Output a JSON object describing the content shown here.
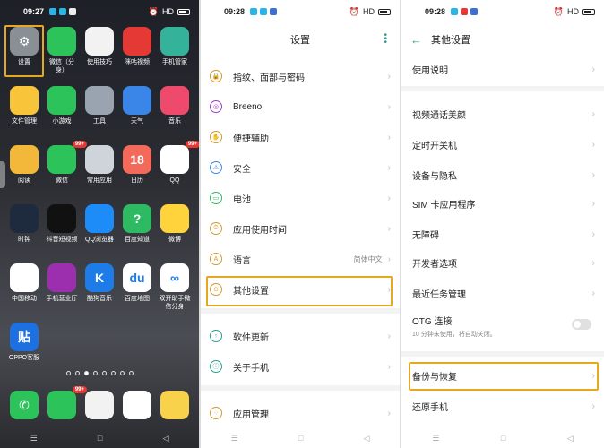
{
  "home": {
    "time": "09:27",
    "apps": [
      {
        "name": "settings",
        "label": "设置",
        "color": "#8a8f96",
        "glyph": "⚙",
        "badge": ""
      },
      {
        "name": "wechat-clone",
        "label": "微信（分\n身）",
        "color": "#2dc35b",
        "glyph": "",
        "badge": ""
      },
      {
        "name": "tips",
        "label": "使用技巧",
        "color": "#f2f2f2",
        "glyph": "",
        "badge": ""
      },
      {
        "name": "miguvideo",
        "label": "咪咕视频",
        "color": "#e53935",
        "glyph": "",
        "badge": ""
      },
      {
        "name": "phone-manager",
        "label": "手机管家",
        "color": "#35b39a",
        "glyph": "",
        "badge": ""
      },
      {
        "name": "file-manager",
        "label": "文件管理",
        "color": "#f7c43a",
        "glyph": "",
        "badge": ""
      },
      {
        "name": "mini-games",
        "label": "小游戏",
        "color": "#2dc35b",
        "glyph": "",
        "badge": ""
      },
      {
        "name": "tools",
        "label": "工具",
        "color": "#9aa3b0",
        "glyph": "",
        "badge": ""
      },
      {
        "name": "weather",
        "label": "天气",
        "color": "#3a86e8",
        "glyph": "",
        "badge": ""
      },
      {
        "name": "music",
        "label": "音乐",
        "color": "#ef4a6b",
        "glyph": "",
        "badge": ""
      },
      {
        "name": "reading",
        "label": "阅读",
        "color": "#f3b73a",
        "glyph": "",
        "badge": ""
      },
      {
        "name": "wechat",
        "label": "微信",
        "color": "#2dc35b",
        "glyph": "",
        "badge": "99+"
      },
      {
        "name": "common-apps",
        "label": "常用应用",
        "color": "#cfd3da",
        "glyph": "",
        "badge": ""
      },
      {
        "name": "calendar",
        "label": "日历",
        "color": "#f36a5a",
        "glyph": "18",
        "badge": ""
      },
      {
        "name": "qq",
        "label": "QQ",
        "color": "#ffffff",
        "glyph": "",
        "badge": "99+"
      },
      {
        "name": "clock",
        "label": "时钟",
        "color": "#1e2a3d",
        "glyph": "",
        "badge": ""
      },
      {
        "name": "douyin",
        "label": "抖音短视频",
        "color": "#111111",
        "glyph": "",
        "badge": ""
      },
      {
        "name": "qq-browser",
        "label": "QQ浏览器",
        "color": "#1d8cf8",
        "glyph": "",
        "badge": ""
      },
      {
        "name": "baidu-zhidao",
        "label": "百度知道",
        "color": "#2dba62",
        "glyph": "?",
        "badge": ""
      },
      {
        "name": "weibo",
        "label": "微博",
        "color": "#ffd33b",
        "glyph": "",
        "badge": ""
      },
      {
        "name": "china-mobile",
        "label": "中国移动",
        "color": "#ffffff",
        "glyph": "",
        "badge": ""
      },
      {
        "name": "mobile-hall",
        "label": "手机营业厅",
        "color": "#9b2fae",
        "glyph": "",
        "badge": ""
      },
      {
        "name": "kugou-music",
        "label": "酷狗音乐",
        "color": "#1e7ce8",
        "glyph": "K",
        "badge": ""
      },
      {
        "name": "baidu-map",
        "label": "百度地图",
        "color": "#ffffff",
        "glyph": "du",
        "badge": ""
      },
      {
        "name": "dual-open",
        "label": "双开助手微\n信分身",
        "color": "#ffffff",
        "glyph": "∞",
        "badge": ""
      },
      {
        "name": "oppo-service",
        "label": "OPPO客服",
        "color": "#1e6fe0",
        "glyph": "贴",
        "badge": ""
      }
    ],
    "dock": [
      {
        "name": "phone",
        "color": "#2dc35b",
        "glyph": "✆",
        "badge": ""
      },
      {
        "name": "messages",
        "color": "#2dc35b",
        "glyph": "",
        "badge": "99+"
      },
      {
        "name": "camera",
        "color": "#f2f2f2",
        "glyph": "",
        "badge": ""
      },
      {
        "name": "browser",
        "color": "#ffffff",
        "glyph": "",
        "badge": ""
      },
      {
        "name": "notes",
        "color": "#f7d24a",
        "glyph": "",
        "badge": ""
      }
    ]
  },
  "settings": {
    "time": "09:28",
    "title": "设置",
    "items": [
      {
        "label": "指纹、面部与密码",
        "value": ""
      },
      {
        "label": "Breeno",
        "value": ""
      },
      {
        "label": "便捷辅助",
        "value": ""
      },
      {
        "label": "安全",
        "value": ""
      },
      {
        "label": "电池",
        "value": ""
      },
      {
        "label": "应用使用时间",
        "value": ""
      },
      {
        "label": "语言",
        "value": "简体中文"
      },
      {
        "label": "其他设置",
        "value": ""
      },
      {
        "label": "软件更新",
        "value": ""
      },
      {
        "label": "关于手机",
        "value": ""
      },
      {
        "label": "应用管理",
        "value": ""
      }
    ]
  },
  "other": {
    "time": "09:28",
    "title": "其他设置",
    "items": [
      "使用说明",
      "视频通话美颜",
      "定时开关机",
      "设备与隐私",
      "SIM 卡应用程序",
      "无障碍",
      "开发者选项",
      "最近任务管理"
    ],
    "otg_label": "OTG 连接",
    "otg_sub": "10 分钟未使用，将自动关闭。",
    "backup": "备份与恢复",
    "reset": "还原手机"
  },
  "status": {
    "signal": "HD",
    "battery_label": ""
  },
  "colors": {
    "accent": "#2a9d8f",
    "highlight": "#e5a820"
  }
}
